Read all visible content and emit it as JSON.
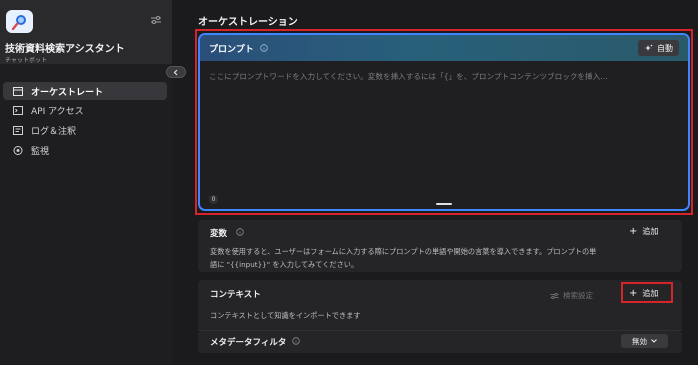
{
  "sidebar": {
    "app_name": "技術資料検索アシスタント",
    "app_type": "チャットボット",
    "items": [
      {
        "label": "オーケストレート",
        "icon": "layout-icon",
        "active": true
      },
      {
        "label": "API アクセス",
        "icon": "terminal-icon",
        "active": false
      },
      {
        "label": "ログ＆注釈",
        "icon": "log-icon",
        "active": false
      },
      {
        "label": "監視",
        "icon": "monitor-icon",
        "active": false
      }
    ]
  },
  "main": {
    "title": "オーケストレーション",
    "prompt": {
      "label": "プロンプト",
      "auto_label": "自動",
      "placeholder": "ここにプロンプトワードを入力してください。変数を挿入するには「{」を、プロンプトコンテンツブロックを挿入…",
      "char_count": "0"
    },
    "variables": {
      "title": "変数",
      "add_label": "追加",
      "description_line1": "変数を使用すると、ユーザーはフォームに入力する際にプロンプトの単語や開始の言葉を導入できます。プロンプトの単",
      "description_line2": "語に \"{{input}}\" を入力してみてください。"
    },
    "context": {
      "title": "コンテキスト",
      "retrieval_setting_label": "検索設定",
      "add_label": "追加",
      "description": "コンテキストとして知識をインポートできます"
    },
    "metadata_filter": {
      "title": "メタデータフィルタ",
      "value": "無効"
    }
  },
  "colors": {
    "accent_blue": "#3d86ff",
    "highlight_red": "#d6252a",
    "background": "#1b1b1d"
  }
}
